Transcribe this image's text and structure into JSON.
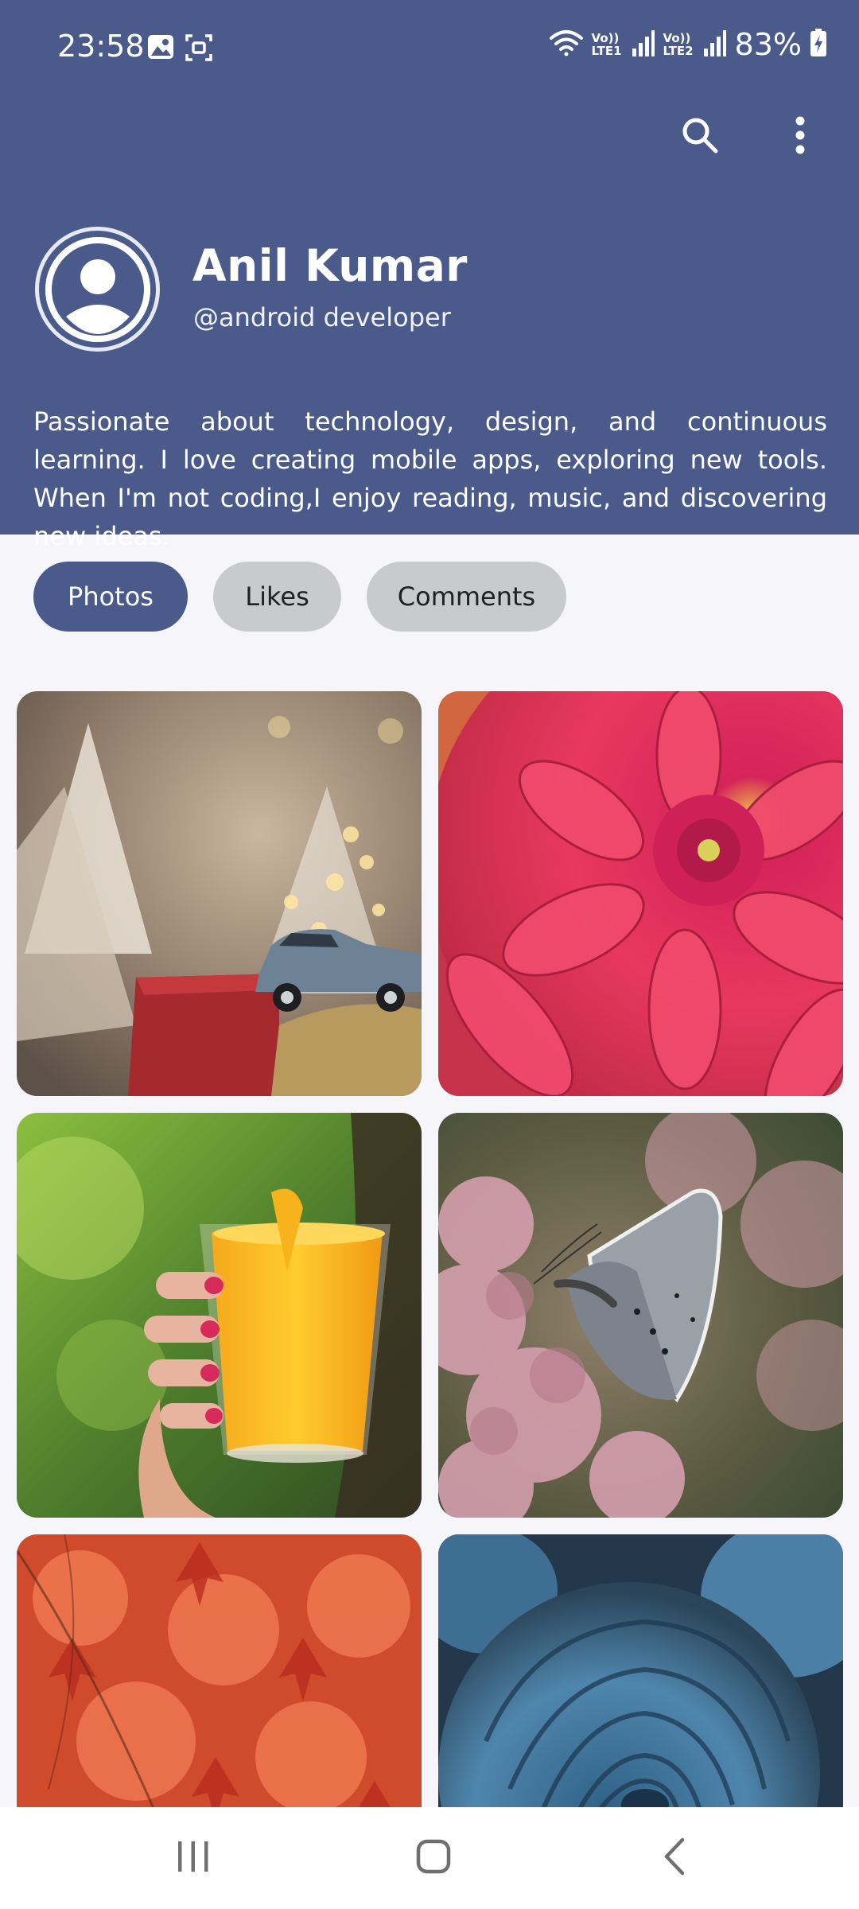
{
  "status_bar": {
    "time": "23:58",
    "sim1_label": "Vo)) LTE1",
    "sim2_label": "Vo)) LTE2",
    "battery_text": "83%",
    "icons": [
      "gallery-notification-icon",
      "screenshot-icon",
      "wifi-icon",
      "signal-icon",
      "battery-charging-icon"
    ]
  },
  "app_bar": {
    "search_icon": "search-icon",
    "more_icon": "more-vert-icon"
  },
  "profile": {
    "name": "Anil Kumar",
    "handle": "@android developer",
    "bio": "Passionate about technology, design, and continuous learning. I love creating mobile apps, exploring new tools. When I'm not coding,I enjoy reading, music, and discovering new ideas.",
    "avatar_icon": "person-avatar-icon"
  },
  "tabs": [
    {
      "label": "Photos",
      "active": true
    },
    {
      "label": "Likes",
      "active": false
    },
    {
      "label": "Comments",
      "active": false
    }
  ],
  "photos": [
    {
      "subject": "toy car on gift box with christmas lights"
    },
    {
      "subject": "pink dahlia flower"
    },
    {
      "subject": "hand holding glass of orange juice"
    },
    {
      "subject": "gray butterfly on pink flowers"
    },
    {
      "subject": "red autumn maple leaves"
    },
    {
      "subject": "blue rose"
    }
  ],
  "nav_bar": {
    "recents_icon": "recent-apps-icon",
    "home_icon": "home-icon",
    "back_icon": "back-icon"
  },
  "colors": {
    "header_bg": "#4a5b8b",
    "page_bg": "#f6f5fa",
    "chip_inactive": "#c9cacb"
  }
}
